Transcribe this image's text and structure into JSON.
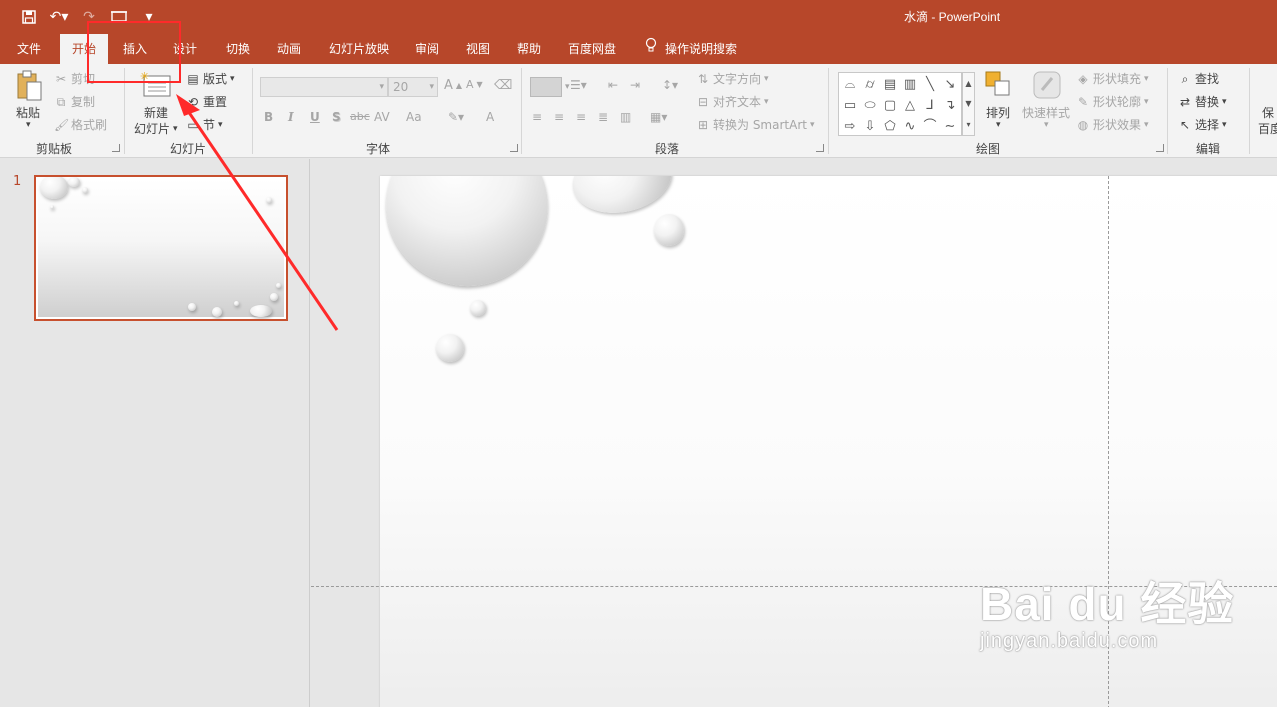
{
  "titlebar": {
    "doc_title": "水滴  -  PowerPoint",
    "qat": [
      "save-icon",
      "undo-icon",
      "redo-icon",
      "slideshow-icon",
      "customize-icon"
    ]
  },
  "tabs": [
    "文件",
    "开始",
    "插入",
    "设计",
    "切换",
    "动画",
    "幻灯片放映",
    "审阅",
    "视图",
    "帮助",
    "百度网盘"
  ],
  "active_tab": "开始",
  "tell_me": "操作说明搜索",
  "ribbon": {
    "clipboard": {
      "paste": "粘贴",
      "cut": "剪切",
      "copy": "复制",
      "format_painter": "格式刷",
      "label": "剪贴板"
    },
    "slides": {
      "new_slide_line1": "新建",
      "new_slide_line2": "幻灯片",
      "layout": "版式",
      "reset": "重置",
      "section": "节",
      "label": "幻灯片"
    },
    "font": {
      "font_name": "",
      "font_size": "20",
      "bold": "B",
      "italic": "I",
      "underline": "U",
      "shadow": "S",
      "strike": "abc",
      "spacing": "AV",
      "case": "Aa",
      "grow": "A",
      "shrink": "A",
      "font_color": "A",
      "label": "字体"
    },
    "paragraph": {
      "text_direction": "文字方向",
      "align_text": "对齐文本",
      "convert_smartart": "转换为 SmartArt",
      "label": "段落"
    },
    "drawing": {
      "arrange": "排列",
      "quick_styles": "快速样式",
      "shape_fill": "形状填充",
      "shape_outline": "形状轮廓",
      "shape_effects": "形状效果",
      "label": "绘图"
    },
    "editing": {
      "find": "查找",
      "replace": "替换",
      "select": "选择",
      "label": "编辑"
    },
    "baidu": {
      "save_line1": "保",
      "save_line2": "百度"
    }
  },
  "slides_panel": {
    "slide_number": "1"
  },
  "watermark": {
    "brand": "Bai du 经验",
    "url": "jingyan.baidu.com"
  },
  "colors": {
    "accent": "#b7472a",
    "highlight": "#ff2a2a"
  }
}
